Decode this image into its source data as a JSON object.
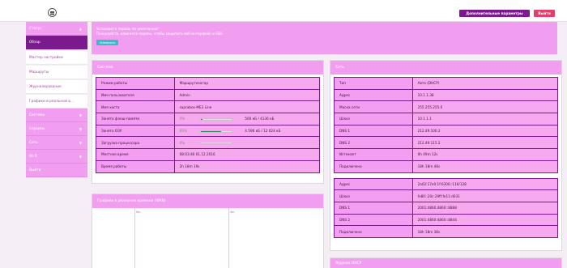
{
  "header": {
    "logo_icon": "router-logo-icon",
    "advanced_button": "Дополнительные параметры",
    "logout_button": "Выйти"
  },
  "sidebar": {
    "items": [
      {
        "label": "Статус",
        "type": "group",
        "chevron": "▲"
      },
      {
        "label": "Обзор",
        "type": "active"
      },
      {
        "label": "Мастер настройки",
        "type": "sub"
      },
      {
        "label": "Маршруты",
        "type": "sub"
      },
      {
        "label": "Журналирование",
        "type": "sub"
      },
      {
        "label": "Графики в реальном в...",
        "type": "sub"
      },
      {
        "label": "Система",
        "type": "group",
        "chevron": "▼"
      },
      {
        "label": "Сервисы",
        "type": "group",
        "chevron": "▼"
      },
      {
        "label": "Сеть",
        "type": "group",
        "chevron": "▼"
      },
      {
        "label": "Wi-Fi",
        "type": "group",
        "chevron": "▼"
      },
      {
        "label": "Выйти",
        "type": "group",
        "chevron": ""
      }
    ]
  },
  "alert": {
    "title": "Установите пароль по умолчанию!",
    "text": "Пожалуйста, измените пароль, чтобы защитить веб-интерфейс и SSH.",
    "button": "Изменить"
  },
  "system_panel": {
    "title": "Система",
    "rows": [
      {
        "key": "Режим работы",
        "value": "Маршрутизатор"
      },
      {
        "key": "Имя пользователя",
        "value": "Admin"
      },
      {
        "key": "Имя хоста",
        "value": "saprabox-ME3 Line"
      },
      {
        "key": "Занято флеш-памяти",
        "value": "5%",
        "progress": 0.05,
        "detail": "560 кБ / 4136 кБ"
      },
      {
        "key": "Занято ОЗУ",
        "value": "65%",
        "progress": 0.65,
        "detail": "4 596 кБ / 12 024 кБ"
      },
      {
        "key": "Загрузка процессора",
        "value": "0%",
        "progress": 0.0,
        "detail": ""
      },
      {
        "key": "Местное время",
        "value": "08:03:46 01.12.2016"
      },
      {
        "key": "Время работы",
        "value": "2h 18m 19s"
      }
    ]
  },
  "chart_panel": {
    "title": "Графики в реальном времени (WAN)",
    "col_labels": [
      "5m",
      "5m"
    ]
  },
  "network_panel": {
    "title": "Сеть",
    "rows": [
      {
        "key": "Тип",
        "value": "Авто (DHCP)"
      },
      {
        "key": "Адрес",
        "value": "10.1.1.38"
      },
      {
        "key": "Маска сети",
        "value": "255.255.255.0"
      },
      {
        "key": "Шлюз",
        "value": "10.1.1.1"
      },
      {
        "key": "DNS 1",
        "value": "212.49.100.2"
      },
      {
        "key": "DNS 2",
        "value": "212.49.115.2"
      },
      {
        "key": "Истекает",
        "value": "0h 49m 12s"
      },
      {
        "key": "Подключено",
        "value": "18h 18m 48s"
      }
    ],
    "rows_v6": [
      {
        "key": "Адрес",
        "value": "2a02:17e0:1f:6300::116/128"
      },
      {
        "key": "Шлюз",
        "value": "fe80::20c:29ff:fe11:d031"
      },
      {
        "key": "DNS 1",
        "value": "2001:4860:4860::8888"
      },
      {
        "key": "DNS 2",
        "value": "2001:4860:4860::8844"
      },
      {
        "key": "Подключено",
        "value": "18h 18m 38s"
      }
    ]
  },
  "bottom_panel": {
    "title": "Журнал DHCP"
  },
  "colors": {
    "accent_dark": "#7a1a8c",
    "accent_pink": "#f29ef0",
    "danger": "#e0406a",
    "progress": "#2e8a5a"
  }
}
